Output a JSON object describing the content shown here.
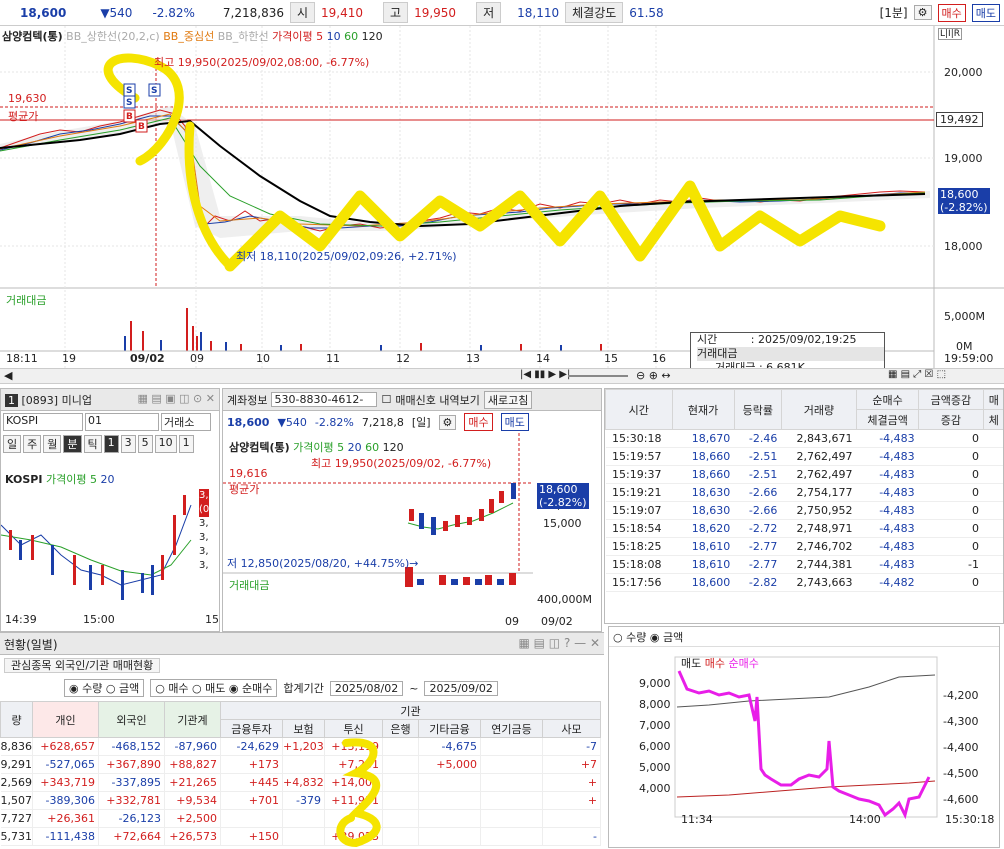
{
  "topbar": {
    "price": "18,600",
    "change": "▼540",
    "rate": "-2.82%",
    "volume": "7,218,836",
    "open_label": "시",
    "open": "19,410",
    "high_label": "고",
    "high": "19,950",
    "low_label": "저",
    "low": "18,110",
    "strength_label": "체결강도",
    "strength": "61.58",
    "period": "[1분]",
    "buy": "매수",
    "sell": "매도"
  },
  "main_chart": {
    "legend_name": "삼양컴텍(통)",
    "legend_bb_up": "BB_상한선(20,2,c)",
    "legend_bb_mid": "BB_중심선",
    "legend_bb_low": "BB_하한선",
    "legend_ma": "가격이평 5",
    "ma10": "10",
    "ma60": "60",
    "ma120": "120",
    "high_note": "최고 19,950(2025/09/02,08:00, -6.77%)",
    "low_note": "최저 18,110(2025/09/02,09:26, +2.71%)",
    "left_price": "19,630",
    "avg_label": "평균가",
    "yaxis": [
      "20,000",
      "19,000",
      "18,000"
    ],
    "right_tag1": "19,492",
    "right_tag2": "18,600",
    "right_tag2b": "(-2.82%)",
    "vol_label": "거래대금",
    "vol_axis": [
      "5,000M",
      "0M"
    ],
    "xaxis": [
      "18:11",
      "19",
      "09/02",
      "09",
      "10",
      "11",
      "12",
      "13",
      "14",
      "15",
      "16",
      "19:59:00"
    ],
    "lir": "L|I|R",
    "tooltip": {
      "time_label": "시간",
      "time_value": ": 2025/09/02,19:25",
      "name": "거래대금",
      "detail": "거래대금 : 6,681K"
    }
  },
  "mini": {
    "title": "[0893] 미니업",
    "market": "KOSPI",
    "code": "01",
    "exchange": "거래소",
    "periods": [
      "일",
      "주",
      "월",
      "분",
      "틱",
      "1",
      "3",
      "5",
      "10"
    ],
    "sel": "1",
    "chart_label": "KOSPI",
    "ma_label": "가격이평 5",
    "ma2": "20",
    "time1": "14:39",
    "time2": "15:00",
    "time3": "15",
    "right_vals": [
      "3,",
      "(0",
      "3,",
      "3,",
      "3,",
      "3,"
    ]
  },
  "account": {
    "label": "계좌정보",
    "acct": "530-8830-4612-",
    "chk": "매매신호 내역보기",
    "refresh": "새로고침",
    "price": "18,600",
    "change": "▼540",
    "rate": "-2.82%",
    "volume": "7,218,8",
    "period": "[일]",
    "buy": "매수",
    "sell": "매도",
    "legend_name": "삼양컴텍(통)",
    "legend_ma": "가격이평 5",
    "ma20": "20",
    "ma60": "60",
    "ma120": "120",
    "high_note": "최고 19,950(2025/09/02, -6.77%)",
    "left_price": "19,616",
    "avg_label": "평균가",
    "yaxis": [
      "20,000",
      "15,000"
    ],
    "tag": "18,600",
    "tag2": "(-2.82%)",
    "low_note": "저 12,850(2025/08/20, +44.75%)→",
    "vol_label": "거래대금",
    "vol_axis": "400,000M",
    "x1": "09",
    "x2": "09/02"
  },
  "ticks": {
    "headers": [
      "시간",
      "현재가",
      "등락률",
      "거래량",
      "순매수",
      "금액증감",
      "매",
      "체결금액",
      "증감",
      "체"
    ],
    "rows": [
      [
        "15:30:18",
        "18,670",
        "-2.46",
        "2,843,671",
        "-4,483",
        "0"
      ],
      [
        "15:19:57",
        "18,660",
        "-2.51",
        "2,762,497",
        "-4,483",
        "0"
      ],
      [
        "15:19:37",
        "18,660",
        "-2.51",
        "2,762,497",
        "-4,483",
        "0"
      ],
      [
        "15:19:21",
        "18,630",
        "-2.66",
        "2,754,177",
        "-4,483",
        "0"
      ],
      [
        "15:19:07",
        "18,630",
        "-2.66",
        "2,750,952",
        "-4,483",
        "0"
      ],
      [
        "15:18:54",
        "18,620",
        "-2.72",
        "2,748,971",
        "-4,483",
        "0"
      ],
      [
        "15:18:25",
        "18,610",
        "-2.77",
        "2,746,702",
        "-4,483",
        "0"
      ],
      [
        "15:18:08",
        "18,610",
        "-2.77",
        "2,744,381",
        "-4,483",
        "-1"
      ],
      [
        "15:17:56",
        "18,600",
        "-2.82",
        "2,743,663",
        "-4,482",
        "0"
      ]
    ]
  },
  "flow_chart": {
    "opt1": "수량",
    "opt2": "금액",
    "legend": [
      "매도",
      "매수",
      "순매수"
    ],
    "yleft": [
      "9,000",
      "8,000",
      "7,000",
      "6,000",
      "5,000",
      "4,000"
    ],
    "yright": [
      "-4,200",
      "-4,300",
      "-4,400",
      "-4,500",
      "-4,600"
    ],
    "x": [
      "11:34",
      "14:00",
      "15:30:18"
    ]
  },
  "bottom": {
    "title": "현황(일별)",
    "tab1": "관심종목 외국인/기관 매매현황",
    "radio1": [
      "수량",
      "금액"
    ],
    "radio2": [
      "매수",
      "매도",
      "순매수"
    ],
    "period_label": "합계기간",
    "from": "2025/08/02",
    "to": "2025/09/02",
    "tilde": "~",
    "group": "기관",
    "headers": [
      "량",
      "개인",
      "외국인",
      "기관계",
      "금융투자",
      "보험",
      "투신",
      "은행",
      "기타금융",
      "연기금등",
      "사모"
    ],
    "rows": [
      [
        "8,836",
        "+628,657",
        "-468,152",
        "-87,960",
        "-24,629",
        "+1,203",
        "+13,119",
        "",
        "-4,675",
        "",
        "-7"
      ],
      [
        "9,291",
        "-527,065",
        "+367,890",
        "+88,827",
        "+173",
        "",
        "+7,281",
        "",
        "+5,000",
        "",
        "+7"
      ],
      [
        "2,569",
        "+343,719",
        "-337,895",
        "+21,265",
        "+445",
        "+4,832",
        "+14,000",
        "",
        "",
        "",
        "+"
      ],
      [
        "1,507",
        "-389,306",
        "+332,781",
        "+9,534",
        "+701",
        "-379",
        "+11,931",
        "",
        "",
        "",
        "+"
      ],
      [
        "7,727",
        "+26,361",
        "-26,123",
        "+2,500",
        "",
        "",
        "",
        "",
        "",
        "",
        ""
      ],
      [
        "5,731",
        "-111,438",
        "+72,664",
        "+26,573",
        "+150",
        "",
        "+29,023",
        "",
        "",
        "",
        "-"
      ]
    ]
  }
}
